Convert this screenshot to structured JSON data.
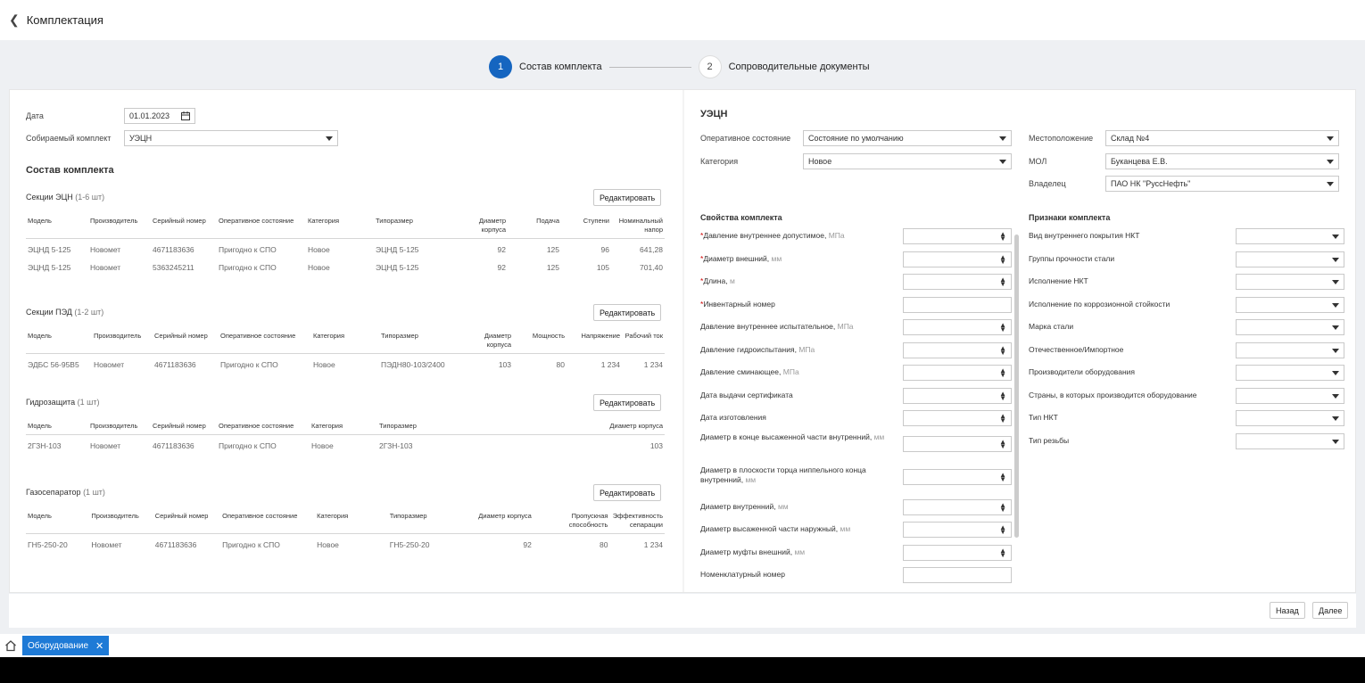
{
  "header": {
    "title": "Комплектация"
  },
  "stepper": {
    "step1": {
      "num": "1",
      "label": "Состав комплекта"
    },
    "step2": {
      "num": "2",
      "label": "Сопроводительные документы"
    }
  },
  "form": {
    "date_label": "Дата",
    "date_value": "01.01.2023",
    "kit_label": "Собираемый комплект",
    "kit_value": "УЭЦН"
  },
  "composition_title": "Состав комплекта",
  "edit_label": "Редактировать",
  "sections": {
    "ecn": {
      "title": "Секции ЭЦН",
      "count": "(1-6 шт)",
      "columns": [
        "Модель",
        "Производитель",
        "Серийный номер",
        "Оперативное состояние",
        "Категория",
        "Типоразмер",
        "Диаметр корпуса",
        "Подача",
        "Ступени",
        "Номинальный напор"
      ],
      "rows": [
        [
          "ЭЦНД 5-125",
          "Новомет",
          "4671183636",
          "Пригодно к СПО",
          "Новое",
          "ЭЦНД 5-125",
          "92",
          "125",
          "96",
          "641,28"
        ],
        [
          "ЭЦНД 5-125",
          "Новомет",
          "5363245211",
          "Пригодно к СПО",
          "Новое",
          "ЭЦНД 5-125",
          "92",
          "125",
          "105",
          "701,40"
        ]
      ]
    },
    "ped": {
      "title": "Секции ПЭД",
      "count": "(1-2 шт)",
      "columns": [
        "Модель",
        "Производитель",
        "Серийный номер",
        "Оперативное состояние",
        "Категория",
        "Типоразмер",
        "Диаметр корпуса",
        "Мощность",
        "Напряжение",
        "Рабочий ток"
      ],
      "rows": [
        [
          "ЭДБС 56-95B5",
          "Новомет",
          "4671183636",
          "Пригодно к СПО",
          "Новое",
          "ПЭДН80-103/2400",
          "103",
          "80",
          "1 234",
          "1 234"
        ]
      ]
    },
    "hydro": {
      "title": "Гидрозащита",
      "count": "(1 шт)",
      "columns": [
        "Модель",
        "Производитель",
        "Серийный номер",
        "Оперативное состояние",
        "Категория",
        "Типоразмер",
        "Диаметр корпуса"
      ],
      "rows": [
        [
          "2ГЗН-103",
          "Новомет",
          "4671183636",
          "Пригодно к СПО",
          "Новое",
          "2ГЗН-103",
          "103"
        ]
      ]
    },
    "gas": {
      "title": "Газосепаратор",
      "count": "(1 шт)",
      "columns": [
        "Модель",
        "Производитель",
        "Серийный номер",
        "Оперативное состояние",
        "Категория",
        "Типоразмер",
        "Диаметр корпуса",
        "Пропускная способность",
        "Эффективность сепарации"
      ],
      "rows": [
        [
          "ГН5-250-20",
          "Новомет",
          "4671183636",
          "Пригодно к СПО",
          "Новое",
          "ГН5-250-20",
          "92",
          "80",
          "1 234"
        ]
      ]
    }
  },
  "kit": {
    "title": "УЭЦН",
    "op_state_label": "Оперативное состояние",
    "op_state_value": "Состояние по умолчанию",
    "category_label": "Категория",
    "category_value": "Новое",
    "location_label": "Местоположение",
    "location_value": "Склад №4",
    "mol_label": "МОЛ",
    "mol_value": "Буканцева Е.В.",
    "owner_label": "Владелец",
    "owner_value": "ПАО НК \"РуссНефть\""
  },
  "properties": {
    "title": "Свойства комплекта",
    "items": [
      {
        "label": "Давление внутреннее допустимое,",
        "unit": "МПа",
        "req": "*",
        "kind": "spin"
      },
      {
        "label": "Диаметр внешний,",
        "unit": "мм",
        "req": "*",
        "kind": "spin"
      },
      {
        "label": "Длина,",
        "unit": "м",
        "req": "*",
        "kind": "spin"
      },
      {
        "label": "Инвентарный номер",
        "unit": "",
        "req": "*",
        "kind": "text"
      },
      {
        "label": "Давление внутреннее испытательное,",
        "unit": "МПа",
        "req": "",
        "kind": "spin"
      },
      {
        "label": "Давление гидроиспытания,",
        "unit": "МПа",
        "req": "",
        "kind": "spin"
      },
      {
        "label": "Давление сминающее,",
        "unit": "МПа",
        "req": "",
        "kind": "spin"
      },
      {
        "label": "Дата выдачи сертификата",
        "unit": "",
        "req": "",
        "kind": "spin"
      },
      {
        "label": "Дата изготовления",
        "unit": "",
        "req": "",
        "kind": "spin"
      },
      {
        "label": "Диаметр в конце высаженной части внутренний,",
        "unit": "мм",
        "req": "",
        "kind": "spin"
      },
      {
        "label": "Диаметр в плоскости торца ниппельного конца внутренний,",
        "unit": "мм",
        "req": "",
        "kind": "spin"
      },
      {
        "label": "Диаметр внутренний,",
        "unit": "мм",
        "req": "",
        "kind": "spin"
      },
      {
        "label": "Диаметр высаженной части наружный,",
        "unit": "мм",
        "req": "",
        "kind": "spin"
      },
      {
        "label": "Диаметр муфты внешний,",
        "unit": "мм",
        "req": "",
        "kind": "spin"
      },
      {
        "label": "Номенклатурный номер",
        "unit": "",
        "req": "",
        "kind": "text"
      }
    ]
  },
  "features": {
    "title": "Признаки комплекта",
    "items": [
      "Вид внутреннего покрытия НКТ",
      "Группы прочности стали",
      "Исполнение НКТ",
      "Исполнение по коррозионной стойкости",
      "Марка стали",
      "Отечественное/Импортное",
      "Производители оборудования",
      "Страны, в которых производится оборудование",
      "Тип НКТ",
      "Тип резьбы"
    ]
  },
  "footer": {
    "back_label": "Назад",
    "next_label": "Далее"
  },
  "taskbar": {
    "tab_label": "Оборудование"
  },
  "colors": {
    "accent": "#1565c0",
    "tab": "#1e7ad6",
    "required": "#cc0000"
  }
}
